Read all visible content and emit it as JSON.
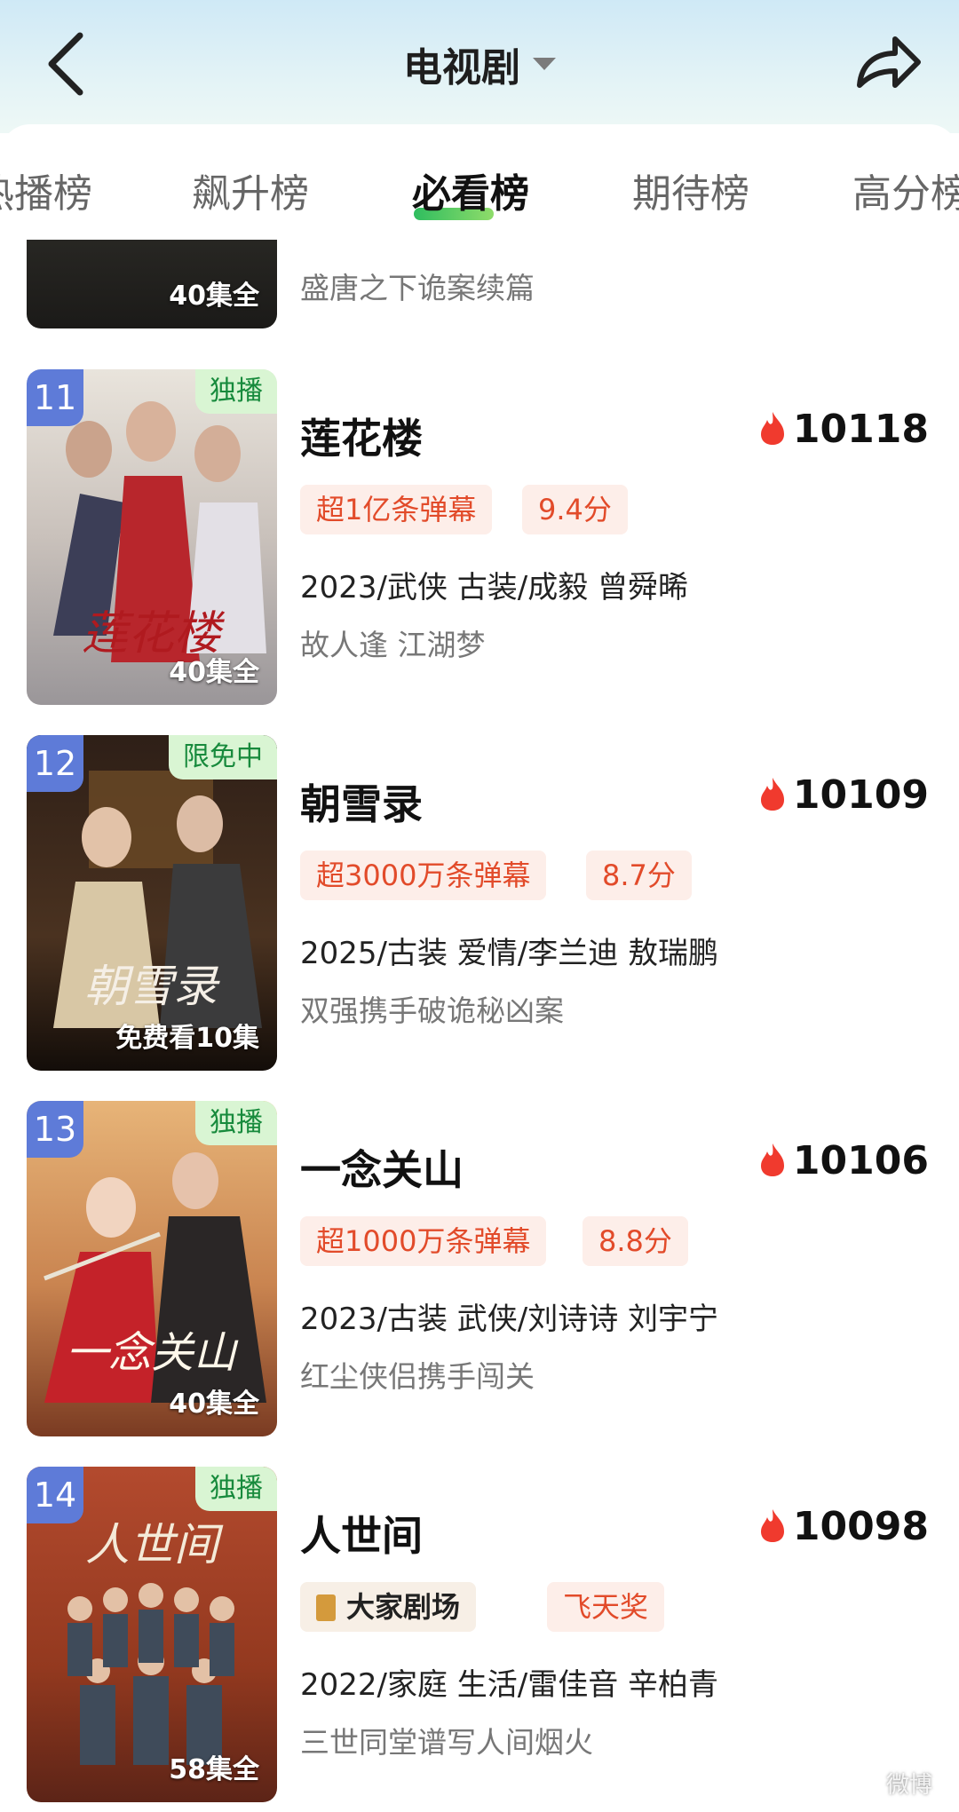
{
  "header": {
    "title": "电视剧"
  },
  "tabs": [
    {
      "label": "热播榜"
    },
    {
      "label": "飙升榜"
    },
    {
      "label": "必看榜"
    },
    {
      "label": "期待榜"
    },
    {
      "label": "高分榜"
    }
  ],
  "partial_item": {
    "episodes": "40集全",
    "desc": "盛唐之下诡案续篇"
  },
  "items": [
    {
      "rank": "11",
      "tag": "独播",
      "name": "莲花楼",
      "heat": "10118",
      "badges": [
        "超1亿条弹幕",
        "9.4分"
      ],
      "meta": "2023/武侠 古装/成毅 曾舜晞",
      "desc": "故人逢 江湖梦",
      "episodes": "40集全",
      "poster_title": "莲花楼"
    },
    {
      "rank": "12",
      "tag": "限免中",
      "name": "朝雪录",
      "heat": "10109",
      "badges": [
        "超3000万条弹幕",
        "8.7分"
      ],
      "meta": "2025/古装 爱情/李兰迪 敖瑞鹏",
      "desc": "双强携手破诡秘凶案",
      "episodes": "免费看10集",
      "poster_title": "朝雪录"
    },
    {
      "rank": "13",
      "tag": "独播",
      "name": "一念关山",
      "heat": "10106",
      "badges": [
        "超1000万条弹幕",
        "8.8分"
      ],
      "meta": "2023/古装 武侠/刘诗诗 刘宇宁",
      "desc": "红尘侠侣携手闯关",
      "episodes": "40集全",
      "poster_title": "一念关山"
    },
    {
      "rank": "14",
      "tag": "独播",
      "name": "人世间",
      "heat": "10098",
      "badges": [
        "大家剧场",
        "飞天奖"
      ],
      "meta": "2022/家庭 生活/雷佳音 辛柏青",
      "desc": "三世同堂谱写人间烟火",
      "episodes": "58集全",
      "poster_title": "人世间"
    }
  ],
  "watermark": "微博",
  "colors": {
    "accent_green": "#2fbd5f",
    "badge_red": "#e24b2a",
    "rank_blue": "#5e7bd8"
  }
}
